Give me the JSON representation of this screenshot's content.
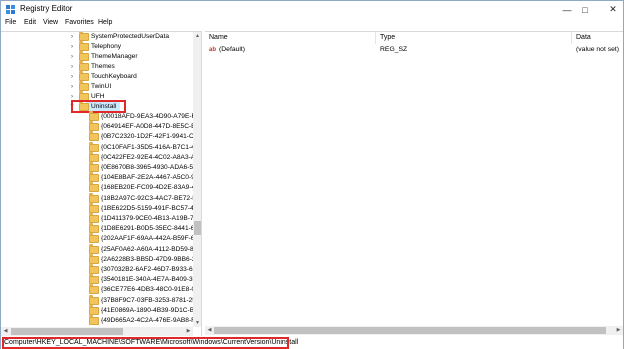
{
  "window": {
    "title": "Registry Editor",
    "accent": "#0078d7",
    "highlight_color": "#e0282a"
  },
  "menu": [
    "File",
    "Edit",
    "View",
    "Favorites",
    "Help"
  ],
  "tree": {
    "items": [
      "SystemProtectedUserData",
      "Telephony",
      "ThemeManager",
      "Themes",
      "TouchKeyboard",
      "TwinUI",
      "UFH",
      "Uninstall"
    ],
    "selected": "Uninstall",
    "subkeys": [
      "{00018AFD-9EA3-4D90-A79E-F",
      "{064914EF-A0D8-447D-8E5C-E8",
      "{0B7C2320-1D2F-42F1-9941-C8",
      "{0C10FAF1-35D5-416A-B7C1-4",
      "{0C422FE2-92E4-4C02-A8A3-A",
      "{0E8670B8-3965-4930-ADA6-57",
      "{104E8BAF-2E2A-4467-A5C0-92",
      "{168EB20E-FC09-4D2E-83A9-49",
      "{18B2A97C-92C3-4AC7-BE72-F",
      "{1BE622D5-5159-491F-BC57-47",
      "{1D411379-9CE0-4B13-A19B-72",
      "{1D8E6291-B0D5-35EC-8441-66",
      "{202AAF1F-69AA-442A-B59F-6",
      "{25AF0A62-A60A-4112-BD59-8",
      "{2A6228B3-BB5D-47D9-9BB6-2",
      "{307032B2-6AF2-46D7-B933-62",
      "{3540181E-340A-4E7A-B409-31",
      "{36CE77E6-4DB3-48C0-91E8-0",
      "{37B8F9C7-03FB-3253-8781-25",
      "{41E0869A-1890-4B39-9D1C-B9",
      "{49D665A2-4C2A-476E-9AB8-F"
    ]
  },
  "list": {
    "headers": {
      "name": "Name",
      "type": "Type",
      "data": "Data"
    },
    "rows": [
      {
        "name": "(Default)",
        "type": "REG_SZ",
        "data": "(value not set)"
      }
    ]
  },
  "status": {
    "path": "Computer\\HKEY_LOCAL_MACHINE\\SOFTWARE\\Microsoft\\Windows\\CurrentVersion\\Uninstall"
  }
}
